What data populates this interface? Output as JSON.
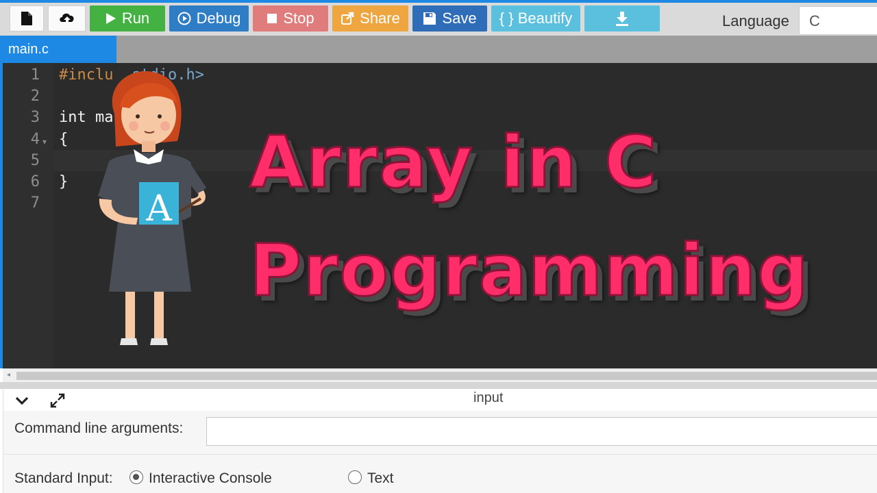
{
  "toolbar": {
    "buttons": [
      {
        "name": "new-file",
        "icon": "file-icon"
      },
      {
        "name": "upload",
        "icon": "upload-cloud-icon"
      },
      {
        "label": "Run",
        "icon": "play-icon",
        "color": "#43b243"
      },
      {
        "label": "Debug",
        "icon": "debug-icon",
        "color": "#2f7dc4"
      },
      {
        "label": "Stop",
        "icon": "stop-icon",
        "color": "#e07c7c"
      },
      {
        "label": "Share",
        "icon": "share-icon",
        "color": "#f0a640"
      },
      {
        "label": "Save",
        "icon": "save-icon",
        "color": "#2f6db8"
      },
      {
        "label": "{ } Beautify",
        "color": "#5bc0de"
      },
      {
        "icon": "download-icon",
        "color": "#5bc0de"
      }
    ],
    "language_label": "Language",
    "language_value": "C"
  },
  "tab": {
    "label": "main.c"
  },
  "editor": {
    "line_numbers": [
      "1",
      "2",
      "3",
      "4",
      "5",
      "6",
      "7"
    ],
    "lines": {
      "l1_pre": "#inclu",
      "l1_hdr": "stdio.h>",
      "l3": "int ma",
      "l4": "{",
      "l6": "}"
    }
  },
  "overlay": {
    "title_line1": "Array in C",
    "title_line2": "Programming",
    "illustration": "teacher-character-holding-letter-a",
    "card_letter": "A"
  },
  "panel": {
    "title": "input",
    "cla_label": "Command line arguments:",
    "stdin_label": "Standard Input:",
    "options": [
      {
        "label": "Interactive Console",
        "checked": true
      },
      {
        "label": "Text",
        "checked": false
      }
    ]
  }
}
